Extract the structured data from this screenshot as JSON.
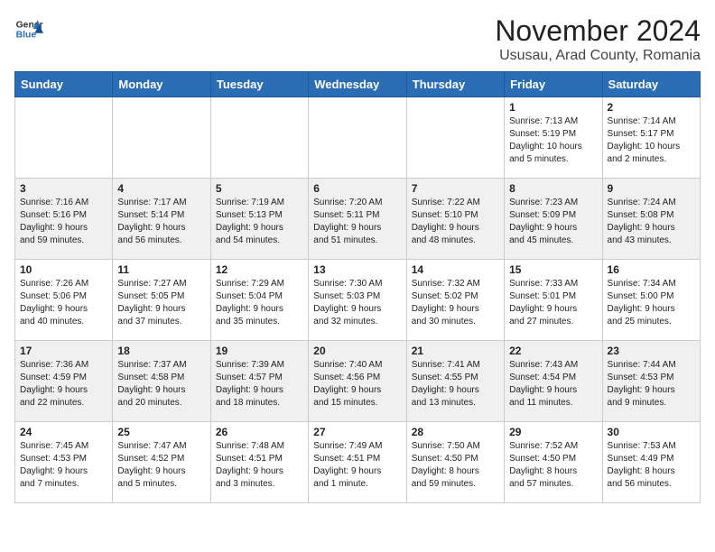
{
  "header": {
    "logo_general": "General",
    "logo_blue": "Blue",
    "month_title": "November 2024",
    "location": "Ususau, Arad County, Romania"
  },
  "days_of_week": [
    "Sunday",
    "Monday",
    "Tuesday",
    "Wednesday",
    "Thursday",
    "Friday",
    "Saturday"
  ],
  "weeks": [
    [
      {
        "day": "",
        "info": ""
      },
      {
        "day": "",
        "info": ""
      },
      {
        "day": "",
        "info": ""
      },
      {
        "day": "",
        "info": ""
      },
      {
        "day": "",
        "info": ""
      },
      {
        "day": "1",
        "info": "Sunrise: 7:13 AM\nSunset: 5:19 PM\nDaylight: 10 hours\nand 5 minutes."
      },
      {
        "day": "2",
        "info": "Sunrise: 7:14 AM\nSunset: 5:17 PM\nDaylight: 10 hours\nand 2 minutes."
      }
    ],
    [
      {
        "day": "3",
        "info": "Sunrise: 7:16 AM\nSunset: 5:16 PM\nDaylight: 9 hours\nand 59 minutes."
      },
      {
        "day": "4",
        "info": "Sunrise: 7:17 AM\nSunset: 5:14 PM\nDaylight: 9 hours\nand 56 minutes."
      },
      {
        "day": "5",
        "info": "Sunrise: 7:19 AM\nSunset: 5:13 PM\nDaylight: 9 hours\nand 54 minutes."
      },
      {
        "day": "6",
        "info": "Sunrise: 7:20 AM\nSunset: 5:11 PM\nDaylight: 9 hours\nand 51 minutes."
      },
      {
        "day": "7",
        "info": "Sunrise: 7:22 AM\nSunset: 5:10 PM\nDaylight: 9 hours\nand 48 minutes."
      },
      {
        "day": "8",
        "info": "Sunrise: 7:23 AM\nSunset: 5:09 PM\nDaylight: 9 hours\nand 45 minutes."
      },
      {
        "day": "9",
        "info": "Sunrise: 7:24 AM\nSunset: 5:08 PM\nDaylight: 9 hours\nand 43 minutes."
      }
    ],
    [
      {
        "day": "10",
        "info": "Sunrise: 7:26 AM\nSunset: 5:06 PM\nDaylight: 9 hours\nand 40 minutes."
      },
      {
        "day": "11",
        "info": "Sunrise: 7:27 AM\nSunset: 5:05 PM\nDaylight: 9 hours\nand 37 minutes."
      },
      {
        "day": "12",
        "info": "Sunrise: 7:29 AM\nSunset: 5:04 PM\nDaylight: 9 hours\nand 35 minutes."
      },
      {
        "day": "13",
        "info": "Sunrise: 7:30 AM\nSunset: 5:03 PM\nDaylight: 9 hours\nand 32 minutes."
      },
      {
        "day": "14",
        "info": "Sunrise: 7:32 AM\nSunset: 5:02 PM\nDaylight: 9 hours\nand 30 minutes."
      },
      {
        "day": "15",
        "info": "Sunrise: 7:33 AM\nSunset: 5:01 PM\nDaylight: 9 hours\nand 27 minutes."
      },
      {
        "day": "16",
        "info": "Sunrise: 7:34 AM\nSunset: 5:00 PM\nDaylight: 9 hours\nand 25 minutes."
      }
    ],
    [
      {
        "day": "17",
        "info": "Sunrise: 7:36 AM\nSunset: 4:59 PM\nDaylight: 9 hours\nand 22 minutes."
      },
      {
        "day": "18",
        "info": "Sunrise: 7:37 AM\nSunset: 4:58 PM\nDaylight: 9 hours\nand 20 minutes."
      },
      {
        "day": "19",
        "info": "Sunrise: 7:39 AM\nSunset: 4:57 PM\nDaylight: 9 hours\nand 18 minutes."
      },
      {
        "day": "20",
        "info": "Sunrise: 7:40 AM\nSunset: 4:56 PM\nDaylight: 9 hours\nand 15 minutes."
      },
      {
        "day": "21",
        "info": "Sunrise: 7:41 AM\nSunset: 4:55 PM\nDaylight: 9 hours\nand 13 minutes."
      },
      {
        "day": "22",
        "info": "Sunrise: 7:43 AM\nSunset: 4:54 PM\nDaylight: 9 hours\nand 11 minutes."
      },
      {
        "day": "23",
        "info": "Sunrise: 7:44 AM\nSunset: 4:53 PM\nDaylight: 9 hours\nand 9 minutes."
      }
    ],
    [
      {
        "day": "24",
        "info": "Sunrise: 7:45 AM\nSunset: 4:53 PM\nDaylight: 9 hours\nand 7 minutes."
      },
      {
        "day": "25",
        "info": "Sunrise: 7:47 AM\nSunset: 4:52 PM\nDaylight: 9 hours\nand 5 minutes."
      },
      {
        "day": "26",
        "info": "Sunrise: 7:48 AM\nSunset: 4:51 PM\nDaylight: 9 hours\nand 3 minutes."
      },
      {
        "day": "27",
        "info": "Sunrise: 7:49 AM\nSunset: 4:51 PM\nDaylight: 9 hours\nand 1 minute."
      },
      {
        "day": "28",
        "info": "Sunrise: 7:50 AM\nSunset: 4:50 PM\nDaylight: 8 hours\nand 59 minutes."
      },
      {
        "day": "29",
        "info": "Sunrise: 7:52 AM\nSunset: 4:50 PM\nDaylight: 8 hours\nand 57 minutes."
      },
      {
        "day": "30",
        "info": "Sunrise: 7:53 AM\nSunset: 4:49 PM\nDaylight: 8 hours\nand 56 minutes."
      }
    ]
  ]
}
